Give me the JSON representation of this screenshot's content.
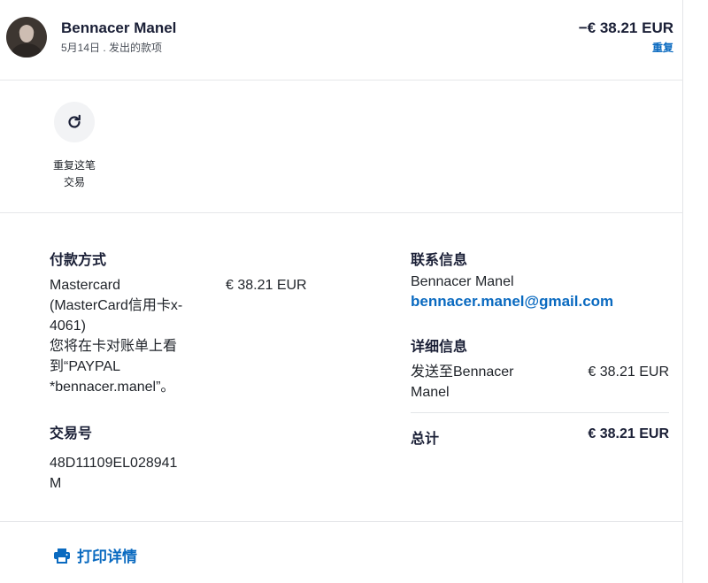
{
  "header": {
    "name": "Bennacer Manel",
    "subtitle": "5月14日 . 发出的款项",
    "amount": "−€ 38.21 EUR",
    "repeat_link": "重复"
  },
  "repeat_action": {
    "label_line1": "重复这笔",
    "label_line2": "交易"
  },
  "payment": {
    "title": "付款方式",
    "lines": [
      "Mastercard",
      "(MasterCard信用卡x-",
      "4061)",
      "您将在卡对账单上看",
      "到“PAYPAL",
      "*bennacer.manel”。"
    ],
    "amount": "€ 38.21 EUR"
  },
  "transaction": {
    "title": "交易号",
    "id_line1": "48D11109EL028941",
    "id_line2": "M"
  },
  "contact": {
    "title": "联系信息",
    "name": "Bennacer Manel",
    "email": "bennacer.manel@gmail.com"
  },
  "details": {
    "title": "详细信息",
    "sent_to_line1": "发送至Bennacer",
    "sent_to_line2": "Manel",
    "sent_amount": "€ 38.21 EUR",
    "total_label": "总计",
    "total_amount": "€ 38.21 EUR"
  },
  "footer": {
    "print_label": "打印详情"
  },
  "colors": {
    "accent": "#0a6ac0",
    "text_dark": "#1a1f36",
    "divider": "#e6e7ea"
  },
  "icons": {
    "repeat": "refresh-icon",
    "print": "printer-icon"
  }
}
